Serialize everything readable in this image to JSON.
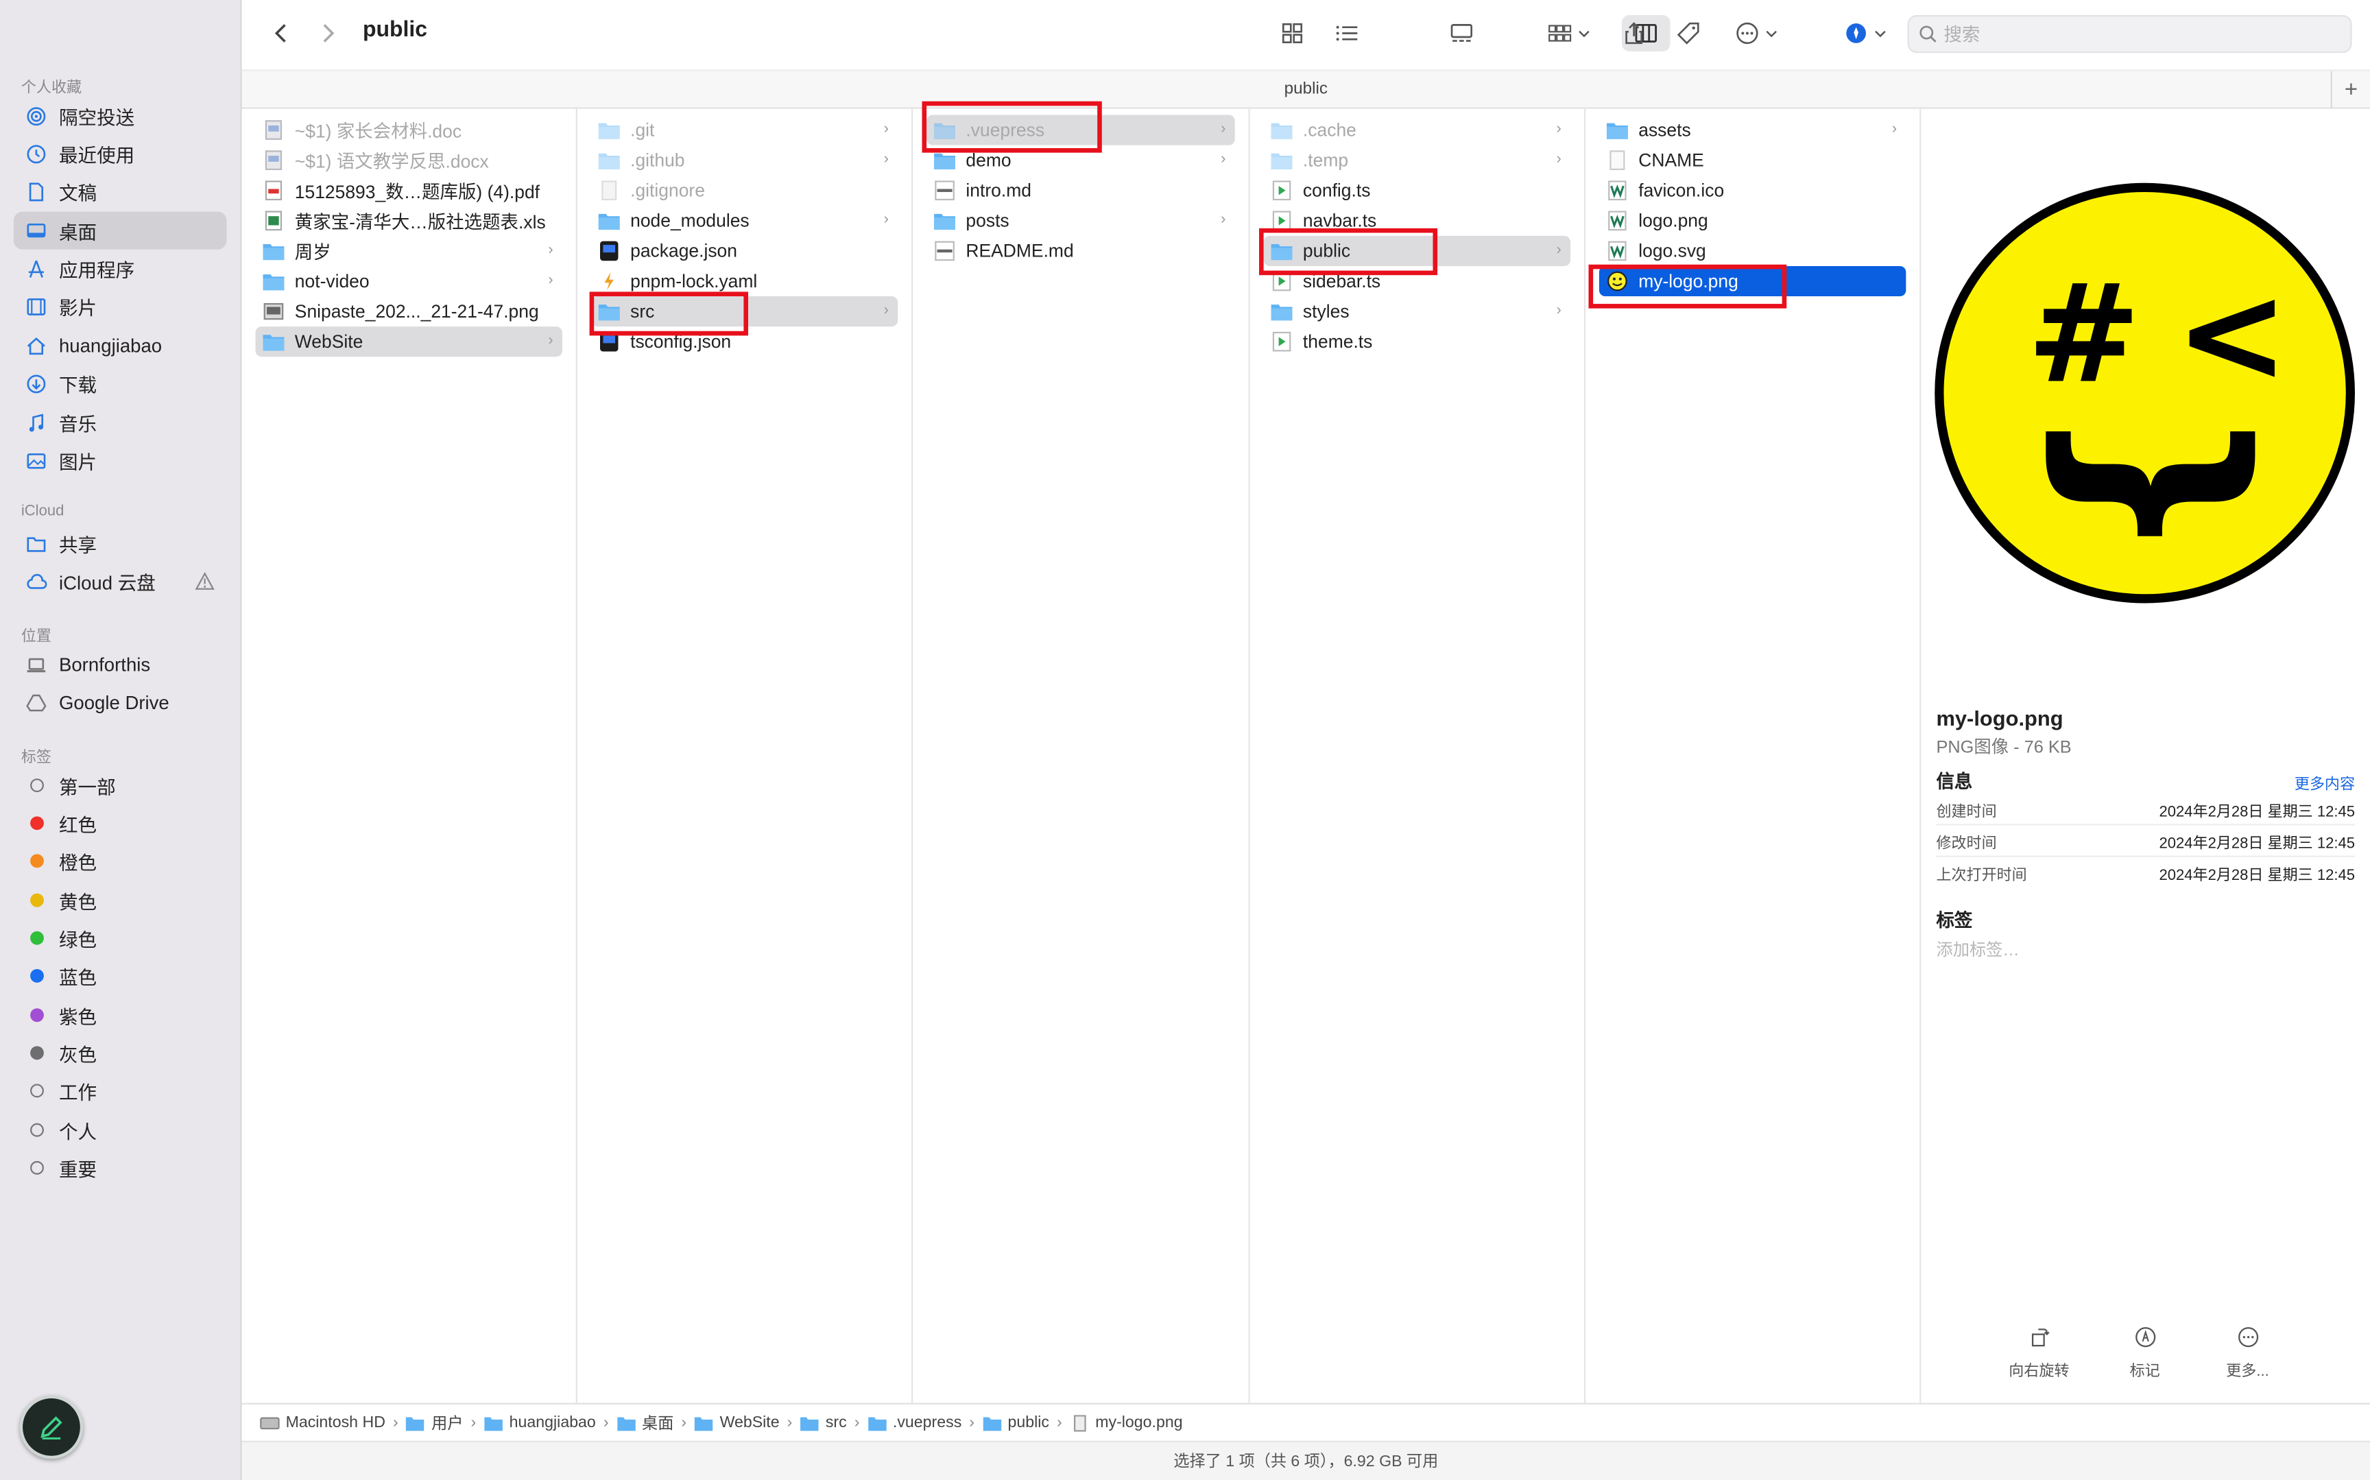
{
  "window": {
    "title": "public",
    "path_title": "public"
  },
  "toolbar": {
    "search_placeholder": "搜索"
  },
  "sidebar": {
    "favorites_label": "个人收藏",
    "favorites": [
      {
        "label": "隔空投送",
        "icon": "airdrop-icon"
      },
      {
        "label": "最近使用",
        "icon": "clock-icon"
      },
      {
        "label": "文稿",
        "icon": "document-icon"
      },
      {
        "label": "桌面",
        "icon": "desktop-icon",
        "selected": true
      },
      {
        "label": "应用程序",
        "icon": "apps-icon"
      },
      {
        "label": "影片",
        "icon": "film-icon"
      },
      {
        "label": "huangjiabao",
        "icon": "home-icon"
      },
      {
        "label": "下载",
        "icon": "download-icon"
      },
      {
        "label": "音乐",
        "icon": "music-icon"
      },
      {
        "label": "图片",
        "icon": "photo-icon"
      }
    ],
    "icloud_label": "iCloud",
    "icloud": [
      {
        "label": "共享",
        "icon": "shared-folder-icon"
      },
      {
        "label": "iCloud 云盘",
        "icon": "cloud-icon"
      }
    ],
    "locations_label": "位置",
    "locations": [
      {
        "label": "Bornforthis",
        "icon": "laptop-icon"
      },
      {
        "label": "Google Drive",
        "icon": "drive-icon"
      }
    ],
    "tags_label": "标签",
    "tags": [
      {
        "label": "第一部",
        "color": ""
      },
      {
        "label": "红色",
        "color": "#f0302b"
      },
      {
        "label": "橙色",
        "color": "#f58a1f"
      },
      {
        "label": "黄色",
        "color": "#e8b80c"
      },
      {
        "label": "绿色",
        "color": "#2fbf3a"
      },
      {
        "label": "蓝色",
        "color": "#1a6ff0"
      },
      {
        "label": "紫色",
        "color": "#a24fd3"
      },
      {
        "label": "灰色",
        "color": "#6e6e70"
      },
      {
        "label": "工作",
        "color": ""
      },
      {
        "label": "个人",
        "color": ""
      },
      {
        "label": "重要",
        "color": ""
      }
    ]
  },
  "columns": {
    "c1": [
      {
        "name": "~$1) 家长会材料.doc",
        "dim": true
      },
      {
        "name": "~$1) 语文教学反思.docx",
        "dim": true
      },
      {
        "name": "15125893_数…题库版) (4).pdf"
      },
      {
        "name": "黄家宝-清华大…版社选题表.xls"
      },
      {
        "name": "周岁"
      },
      {
        "name": "not-video"
      },
      {
        "name": "Snipaste_202..._21-21-47.png"
      },
      {
        "name": "WebSite"
      }
    ],
    "c2": [
      {
        "name": ".git",
        "dim": true
      },
      {
        "name": ".github",
        "dim": true
      },
      {
        "name": ".gitignore",
        "dim": true
      },
      {
        "name": "node_modules"
      },
      {
        "name": "package.json"
      },
      {
        "name": "pnpm-lock.yaml"
      },
      {
        "name": "src"
      },
      {
        "name": "tsconfig.json"
      }
    ],
    "c3": [
      {
        "name": ".vuepress",
        "dim": true
      },
      {
        "name": "demo"
      },
      {
        "name": "intro.md"
      },
      {
        "name": "posts"
      },
      {
        "name": "README.md"
      }
    ],
    "c4": [
      {
        "name": ".cache",
        "dim": true
      },
      {
        "name": ".temp",
        "dim": true
      },
      {
        "name": "config.ts"
      },
      {
        "name": "navbar.ts"
      },
      {
        "name": "public"
      },
      {
        "name": "sidebar.ts"
      },
      {
        "name": "styles"
      },
      {
        "name": "theme.ts"
      }
    ],
    "c5": [
      {
        "name": "assets"
      },
      {
        "name": "CNAME"
      },
      {
        "name": "favicon.ico"
      },
      {
        "name": "logo.png"
      },
      {
        "name": "logo.svg"
      },
      {
        "name": "my-logo.png"
      }
    ]
  },
  "preview": {
    "logo_symbols": {
      "left": "#",
      "right": "<",
      "mouth": "}"
    },
    "file_name": "my-logo.png",
    "file_type": "PNG图像 - 76 KB",
    "info_label": "信息",
    "more_label": "更多内容",
    "rows": [
      {
        "label": "创建时间",
        "value": "2024年2月28日 星期三 12:45"
      },
      {
        "label": "修改时间",
        "value": "2024年2月28日 星期三 12:45"
      },
      {
        "label": "上次打开时间",
        "value": "2024年2月28日 星期三 12:45"
      }
    ],
    "tags_label": "标签",
    "add_tag": "添加标签…",
    "actions": [
      {
        "label": "向右旋转"
      },
      {
        "label": "标记"
      },
      {
        "label": "更多..."
      }
    ]
  },
  "breadcrumbs": [
    "Macintosh HD",
    "用户",
    "huangjiabao",
    "桌面",
    "WebSite",
    "src",
    ".vuepress",
    "public",
    "my-logo.png"
  ],
  "status": "选择了 1 项（共 6 项），6.92 GB 可用"
}
